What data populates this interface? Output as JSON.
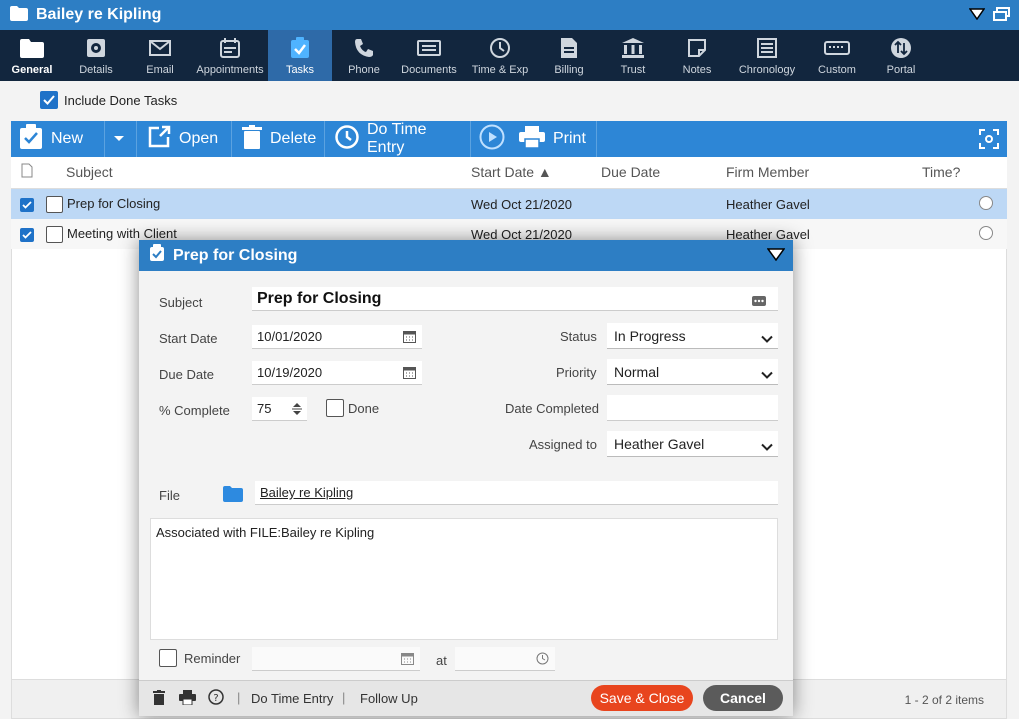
{
  "window": {
    "title": "Bailey re Kipling"
  },
  "nav": [
    {
      "label": "General",
      "icon": "folder-icon"
    },
    {
      "label": "Details",
      "icon": "gear-icon"
    },
    {
      "label": "Email",
      "icon": "envelope-icon"
    },
    {
      "label": "Appointments",
      "icon": "calendar-icon"
    },
    {
      "label": "Tasks",
      "icon": "tasks-icon"
    },
    {
      "label": "Phone",
      "icon": "phone-icon"
    },
    {
      "label": "Documents",
      "icon": "documents-icon"
    },
    {
      "label": "Time & Exp",
      "icon": "clock-icon"
    },
    {
      "label": "Billing",
      "icon": "billing-icon"
    },
    {
      "label": "Trust",
      "icon": "bank-icon"
    },
    {
      "label": "Notes",
      "icon": "note-icon"
    },
    {
      "label": "Chronology",
      "icon": "chronology-icon"
    },
    {
      "label": "Custom",
      "icon": "keyboard-icon"
    },
    {
      "label": "Portal",
      "icon": "portal-icon"
    }
  ],
  "filters": {
    "include_done_label": "Include Done Tasks",
    "include_done_checked": true
  },
  "toolbar": {
    "new": "New",
    "open": "Open",
    "delete": "Delete",
    "time_entry": "Do Time Entry",
    "print": "Print"
  },
  "grid": {
    "headers": {
      "subject": "Subject",
      "start_date": "Start Date ▲",
      "due_date": "Due Date",
      "firm_member": "Firm Member",
      "time": "Time?"
    },
    "rows": [
      {
        "subject": "Prep for Closing",
        "start_date": "Wed Oct 21/2020",
        "due_date": "",
        "firm_member": "Heather Gavel"
      },
      {
        "subject": "Meeting with Client",
        "start_date": "Wed Oct 21/2020",
        "due_date": "",
        "firm_member": "Heather Gavel"
      }
    ],
    "footer_count": "1 - 2 of 2 items"
  },
  "dialog": {
    "title": "Prep for Closing",
    "labels": {
      "subject": "Subject",
      "start_date": "Start Date",
      "due_date": "Due Date",
      "percent_complete": "% Complete",
      "done": "Done",
      "status": "Status",
      "priority": "Priority",
      "date_completed": "Date Completed",
      "assigned_to": "Assigned to",
      "file": "File",
      "reminder": "Reminder",
      "at": "at"
    },
    "values": {
      "subject": "Prep for Closing",
      "start_date": "10/01/2020",
      "due_date": "10/19/2020",
      "percent_complete": "75",
      "status": "In Progress",
      "priority": "Normal",
      "date_completed": "",
      "assigned_to": "Heather Gavel",
      "file": "Bailey re Kipling",
      "notes": "Associated with FILE:Bailey re Kipling"
    },
    "footer": {
      "time_entry": "Do Time Entry",
      "follow_up": "Follow Up",
      "save_close": "Save & Close",
      "cancel": "Cancel",
      "sep": "|"
    }
  },
  "colors": {
    "title_bar": "#2d7ec4",
    "nav_bar": "#12263e",
    "toolbar": "#2d86d6",
    "save": "#e8451e",
    "cancel": "#5b5b5b"
  }
}
